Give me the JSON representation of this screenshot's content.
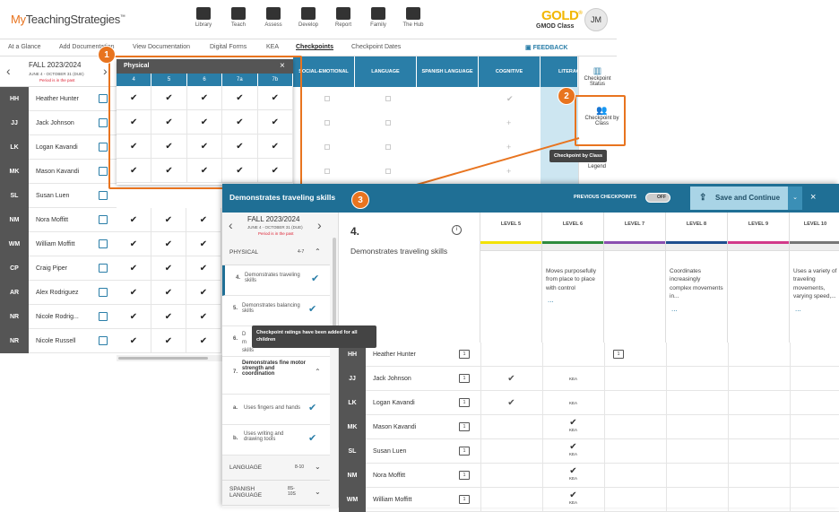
{
  "app": {
    "logo_my": "My",
    "logo_rest": "TeachingStrategies",
    "tm": "™"
  },
  "nav": [
    {
      "label": "Library",
      "icon": "books-icon"
    },
    {
      "label": "Teach",
      "icon": "book-icon"
    },
    {
      "label": "Assess",
      "icon": "pencil-icon"
    },
    {
      "label": "Develop",
      "icon": "bar-chart-icon"
    },
    {
      "label": "Report",
      "icon": "report-icon"
    },
    {
      "label": "Family",
      "icon": "family-icon"
    },
    {
      "label": "The Hub",
      "icon": "chat-icon"
    }
  ],
  "brand": {
    "gold": "GOLD",
    "tm": "®",
    "class": "GMOD Class",
    "avatar": "JM"
  },
  "subnav": [
    "At a Glance",
    "Add Documentation",
    "View Documentation",
    "Digital Forms",
    "KEA",
    "Checkpoints",
    "Checkpoint Dates"
  ],
  "feedback": "FEEDBACK",
  "season": {
    "title": "FALL 2023/2024",
    "dates": "JUNE 4 - OCTOBER 31 (DUE)",
    "note": "Period is in the past"
  },
  "children": [
    {
      "ini": "HH",
      "name": "Heather Hunter"
    },
    {
      "ini": "JJ",
      "name": "Jack Johnson"
    },
    {
      "ini": "LK",
      "name": "Logan Kavandi"
    },
    {
      "ini": "MK",
      "name": "Mason Kavandi"
    },
    {
      "ini": "SL",
      "name": "Susan Luen"
    },
    {
      "ini": "NM",
      "name": "Nora Moffitt"
    },
    {
      "ini": "WM",
      "name": "William Moffitt"
    },
    {
      "ini": "CP",
      "name": "Craig Piper"
    },
    {
      "ini": "AR",
      "name": "Alex Rodriguez"
    },
    {
      "ini": "NR",
      "name": "Nicole Rodrig..."
    },
    {
      "ini": "NR",
      "name": "Nicole Russell"
    }
  ],
  "area_headers": [
    "SOCIAL-EMOTIONAL",
    "LANGUAGE",
    "SPANISH LANGUAGE",
    "COGNITIVE",
    "LITERACY"
  ],
  "physical_popup": {
    "title": "Physical",
    "close": "×",
    "cols": [
      "4",
      "5",
      "6",
      "7a",
      "7b"
    ],
    "check": "✔"
  },
  "right_side": {
    "status_label": "Checkpoint Status",
    "byclass_label": "Checkpoint by Class",
    "tooltip": "Checkpoint by Class",
    "legend": "Legend"
  },
  "callouts": [
    "1",
    "2",
    "3"
  ],
  "panel2": {
    "title": "Demonstrates traveling skills",
    "prev_label": "PREVIOUS CHECKPOINTS",
    "toggle": "OFF",
    "save": "Save and Continue",
    "close": "×",
    "season_title": "FALL 2023/2024",
    "season_dates": "JUNE 4 - OCTOBER 31 (DUE)",
    "season_note": "Period is in the past",
    "skill_num": "4.",
    "skill_name": "Demonstrates traveling skills",
    "info": "i",
    "sidebar": {
      "physical": "PHYSICAL",
      "physical_range": "4-7",
      "items": [
        {
          "num": "4.",
          "label": "Demonstrates traveling skills"
        },
        {
          "num": "5.",
          "label": "Demonstrates balancing skills"
        },
        {
          "num": "6.",
          "label": "Demonstrates gross-motor manipulative skills"
        }
      ],
      "item7_num": "7.",
      "item7_label": "Demonstrates fine motor strength and coordination",
      "sub_a_num": "a.",
      "sub_a": "Uses fingers and hands",
      "sub_b_num": "b.",
      "sub_b": "Uses writing and drawing tools",
      "language": "LANGUAGE",
      "language_range": "8-10",
      "spanish": "SPANISH LANGUAGE",
      "spanish_range": "8S-10S",
      "frag_d": "D",
      "frag_m": "m",
      "frag_skills": "skills"
    },
    "tooltip_ratings": "Checkpoint ratings have been added for all children",
    "levels": [
      {
        "label": "LEVEL 5",
        "color": "#f2e205",
        "text": ""
      },
      {
        "label": "LEVEL 6",
        "color": "#2e8b3e",
        "text": "Moves purposefully from place to place with control"
      },
      {
        "label": "LEVEL 7",
        "color": "#8a4fb0",
        "text": ""
      },
      {
        "label": "LEVEL 8",
        "color": "#1f4f8f",
        "text": "Coordinates increasingly complex movements in..."
      },
      {
        "label": "LEVEL 9",
        "color": "#d23a8a",
        "text": ""
      },
      {
        "label": "LEVEL 10",
        "color": "#777777",
        "text": "Uses a variety of traveling movements, varying speed,..."
      }
    ],
    "more": "...",
    "children": [
      {
        "ini": "HH",
        "name": "Heather Hunter",
        "l5": "",
        "l6": "",
        "folder7": true
      },
      {
        "ini": "JJ",
        "name": "Jack Johnson",
        "l5": "✔",
        "l6": "KEA"
      },
      {
        "ini": "LK",
        "name": "Logan Kavandi",
        "l5": "✔",
        "l6": "KEA"
      },
      {
        "ini": "MK",
        "name": "Mason Kavandi",
        "l5": "",
        "l6": "✔KEA"
      },
      {
        "ini": "SL",
        "name": "Susan Luen",
        "l5": "",
        "l6": "✔KEA"
      },
      {
        "ini": "NM",
        "name": "Nora Moffitt",
        "l5": "",
        "l6": "✔KEA"
      },
      {
        "ini": "WM",
        "name": "William Moffitt",
        "l5": "",
        "l6": "✔KEA"
      }
    ]
  },
  "colors": {
    "blue": "#2a7ea8",
    "darkblue": "#1f6f95",
    "orange": "#e8741f",
    "gray": "#555555"
  }
}
